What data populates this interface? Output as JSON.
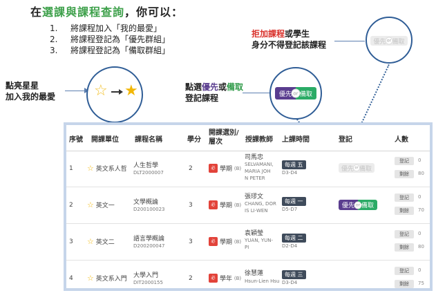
{
  "headline": {
    "prefix": "在",
    "highlight": "選課與課程查詢",
    "suffix": "，你可以："
  },
  "steps": [
    {
      "num": "1.",
      "text": "將課程加入「我的最愛」"
    },
    {
      "num": "2.",
      "text": "將課程登記為「優先群組」"
    },
    {
      "num": "3.",
      "text": "將課程登記為「備取群組」"
    }
  ],
  "callout_star": {
    "line1": "點亮星星",
    "line2": "加入我的最愛"
  },
  "callout_register": {
    "priority": "優先",
    "or": "或",
    "alt": "備取",
    "lead": "點選",
    "line2": "登記課程"
  },
  "callout_blocked": {
    "red": "拒加課程",
    "rest": "或學生",
    "line2": "身分不得登記該課程"
  },
  "toggle": {
    "priority": "優先",
    "alt": "備取",
    "knob": "or"
  },
  "table": {
    "headers": {
      "seq": "序號",
      "unit": "開課單位",
      "name": "課程名稱",
      "credits": "學分",
      "type_l1": "開課選別/",
      "type_l2": "層次",
      "teacher": "授課教師",
      "time": "上課時間",
      "register": "登記",
      "people": "人數"
    },
    "btn_register": "登記",
    "btn_enrolled": "剩餘",
    "rows": [
      {
        "seq": "1",
        "unit": "英文系人哲",
        "name": "人生哲學",
        "code": "DLT2000007",
        "credits": "2",
        "type_tag": "必",
        "type": "學期",
        "level": "(B)",
        "teacher_l1": "司馬忠",
        "teacher_l2": "SELVAMANI,",
        "teacher_l3": "MARIA JOH",
        "teacher_l4": "N PETER",
        "day": "每週 五",
        "period": "D3-D4",
        "register_count": "0",
        "remaining": "80"
      },
      {
        "seq": "2",
        "unit": "英文一",
        "name": "文學概論",
        "code": "D200100023",
        "credits": "3",
        "type_tag": "必",
        "type": "學期",
        "level": "(B)",
        "teacher_l1": "張璆文",
        "teacher_l2": "CHANG, DOR",
        "teacher_l3": "IS LI-WEN",
        "teacher_l4": "",
        "day": "每週 一",
        "period": "D5-D7",
        "register_count": "0",
        "remaining": "70"
      },
      {
        "seq": "3",
        "unit": "英文二",
        "name": "語言學概論",
        "code": "D200200047",
        "credits": "3",
        "type_tag": "必",
        "type": "學期",
        "level": "(B)",
        "teacher_l1": "袁穎瑩",
        "teacher_l2": "YUAN, YUN-",
        "teacher_l3": "PI",
        "teacher_l4": "",
        "day": "每週 二",
        "period": "D2-D4",
        "register_count": "0",
        "remaining": "80"
      },
      {
        "seq": "4",
        "unit": "英文系入門",
        "name": "大學入門",
        "code": "DIT2000155",
        "credits": "2",
        "type_tag": "必",
        "type": "學年",
        "level": "(B)",
        "teacher_l1": "徐慧蓮",
        "teacher_l2": "Hsun-Lien Hsu",
        "teacher_l3": "",
        "teacher_l4": "",
        "day": "每週 三",
        "period": "D3-D4",
        "register_count": "0",
        "remaining": "75"
      }
    ]
  },
  "colors": {
    "accent_green": "#3da04a",
    "priority_purple": "#5a3d8f",
    "alt_green": "#2bab66",
    "blocked_red": "#d9322c",
    "frame_blue": "#c6d5ea"
  },
  "icons": {
    "empty_star": "star-outline-icon",
    "full_star": "star-filled-icon"
  }
}
